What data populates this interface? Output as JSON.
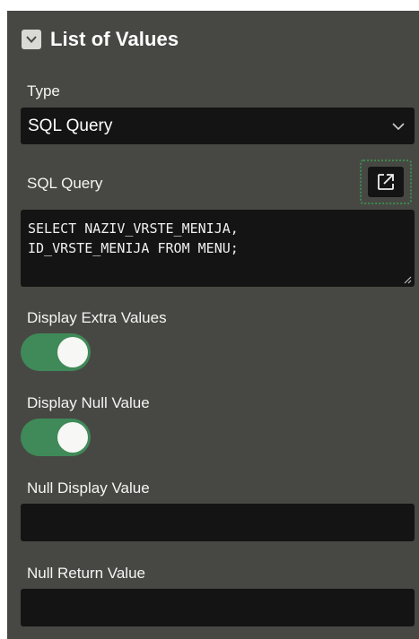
{
  "section": {
    "title": "List of Values"
  },
  "type_field": {
    "label": "Type",
    "value": "SQL Query"
  },
  "sql_field": {
    "label": "SQL Query",
    "lines": [
      "SELECT NAZIV_VRSTE_MENIJA,",
      "ID_VRSTE_MENIJA FROM MENU;"
    ]
  },
  "display_extra": {
    "label": "Display Extra Values",
    "on": true
  },
  "display_null": {
    "label": "Display Null Value",
    "on": true
  },
  "null_display": {
    "label": "Null Display Value",
    "value": ""
  },
  "null_return": {
    "label": "Null Return Value",
    "value": ""
  },
  "colors": {
    "panel": "#474843",
    "field": "#141414",
    "toggle_on": "#3f8a58",
    "focus_ring": "#3c8a50"
  }
}
